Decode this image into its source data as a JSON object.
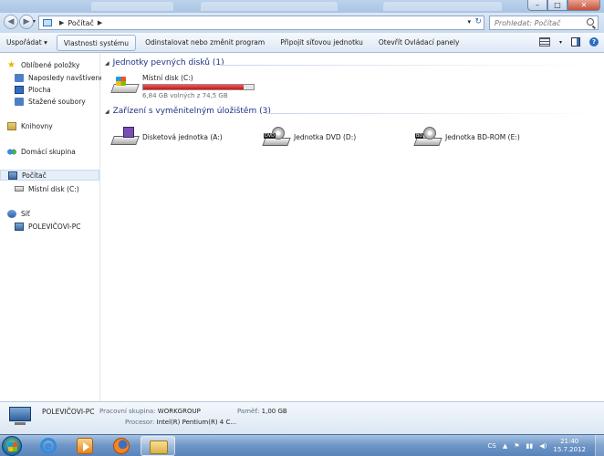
{
  "window": {
    "minimize_symbol": "–",
    "maximize_symbol": "□",
    "close_symbol": "✕"
  },
  "nav": {
    "back_symbol": "◀",
    "forward_symbol": "▶",
    "breadcrumb": "Počítač",
    "search_placeholder": "Prohledat: Počítač"
  },
  "toolbar": {
    "organize": "Uspořádat ▾",
    "system_properties": "Vlastnosti systému",
    "uninstall": "Odinstalovat nebo změnit program",
    "map_drive": "Připojit síťovou jednotku",
    "control_panel": "Otevřít Ovládací panely",
    "help_symbol": "?"
  },
  "sidebar": {
    "favorites": "Oblíbené položky",
    "recent": "Naposledy navštívené",
    "desktop": "Plocha",
    "downloads": "Stažené soubory",
    "libraries": "Knihovny",
    "homegroup": "Domácí skupina",
    "computer": "Počítač",
    "local_disk": "Místní disk (C:)",
    "network": "Síť",
    "network_pc": "POLEVIČOVI-PC"
  },
  "content": {
    "hdd_group": "Jednotky pevných disků (1)",
    "removable_group": "Zařízení s vyměnitelným úložištěm (3)",
    "local_disk_name": "Místní disk (C:)",
    "local_disk_free": "6,84 GB volných z 74,5 GB",
    "local_disk_used_fraction": 0.908,
    "floppy": "Disketová jednotka (A:)",
    "dvd": "Jednotka DVD (D:)",
    "dvd_badge": "DVD",
    "bd": "Jednotka BD-ROM (E:)",
    "bd_badge": "BD"
  },
  "details": {
    "pc_name": "POLEVIČOVI-PC",
    "workgroup_label": "Pracovní skupina:",
    "workgroup_value": "WORKGROUP",
    "memory_label": "Paměť:",
    "memory_value": "1,00 GB",
    "processor_label": "Procesor:",
    "processor_value": "Intel(R) Pentium(R) 4 C..."
  },
  "taskbar": {
    "language": "CS",
    "time": "21:40",
    "date": "15.7.2012"
  }
}
